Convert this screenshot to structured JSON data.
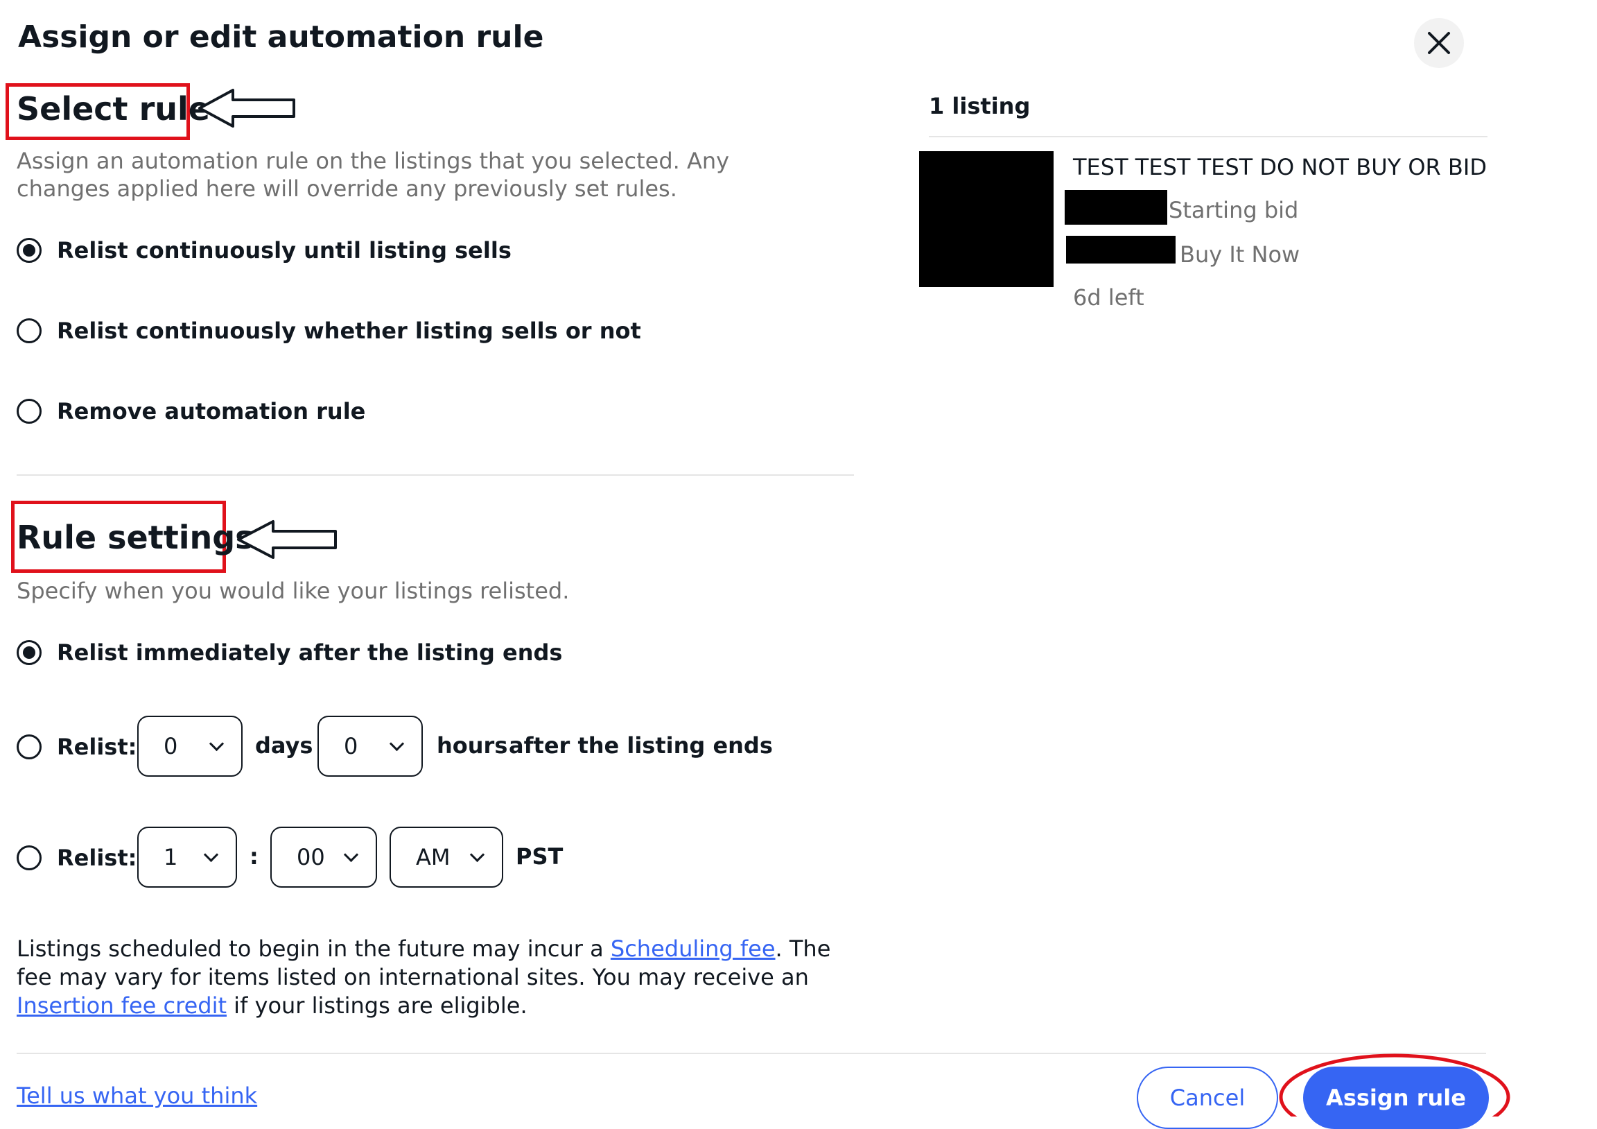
{
  "dialog": {
    "title": "Assign or edit automation rule",
    "close_icon": "close-icon"
  },
  "select_rule": {
    "heading": "Select rule",
    "description": "Assign an automation rule on the listings that you selected. Any changes applied here will override any previously set rules.",
    "options": [
      {
        "label": "Relist continuously until listing sells",
        "checked": true
      },
      {
        "label": "Relist continuously whether listing sells or not",
        "checked": false
      },
      {
        "label": "Remove automation rule",
        "checked": false
      }
    ]
  },
  "rule_settings": {
    "heading": "Rule settings",
    "description": "Specify when you would like your listings relisted.",
    "option_immediate": {
      "label": "Relist immediately after the listing ends",
      "checked": true
    },
    "option_delay": {
      "label": "Relist:",
      "days_value": "0",
      "days_label": "days",
      "hours_value": "0",
      "hours_label": "hours",
      "suffix": "after the listing ends",
      "checked": false
    },
    "option_time": {
      "label": "Relist:",
      "hour_value": "1",
      "separator": ":",
      "minute_value": "00",
      "ampm_value": "AM",
      "timezone": "PST",
      "checked": false
    }
  },
  "fee_note": {
    "part1": "Listings scheduled to begin in the future may incur a ",
    "link1": "Scheduling fee",
    "part2": ". The fee may vary for items listed on international sites. You may receive an ",
    "link2": "Insertion fee credit",
    "part3": " if your listings are eligible."
  },
  "listing_panel": {
    "count": "1 listing",
    "item": {
      "title": "TEST TEST TEST DO NOT BUY OR BID",
      "starting_bid_label": "Starting bid",
      "buy_it_now_label": "Buy It Now",
      "time_left": "6d left"
    }
  },
  "footer": {
    "feedback_link": "Tell us what you think",
    "cancel_label": "Cancel",
    "assign_label": "Assign rule"
  },
  "annotations": {
    "highlight_color": "#e0111b",
    "accent_color": "#3665f3"
  }
}
